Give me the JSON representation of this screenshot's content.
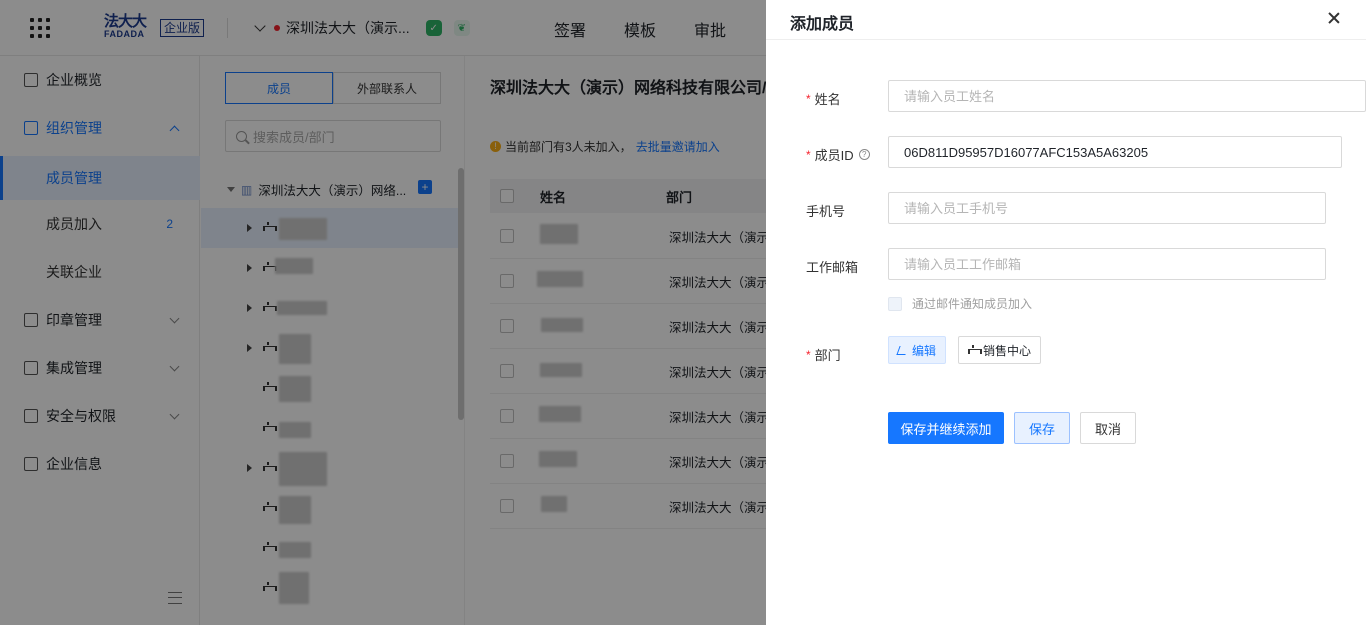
{
  "topbar": {
    "logo_zh": "法大大",
    "logo_en": "FADADA",
    "edition": "企业版",
    "org_name": "深圳法大大（演示...",
    "nav": [
      "签署",
      "模板",
      "审批"
    ]
  },
  "sidebar": {
    "items": [
      {
        "label": "企业概览"
      },
      {
        "label": "组织管理"
      },
      {
        "label": "成员管理"
      },
      {
        "label": "成员加入",
        "count": "2"
      },
      {
        "label": "关联企业"
      },
      {
        "label": "印章管理"
      },
      {
        "label": "集成管理"
      },
      {
        "label": "安全与权限"
      },
      {
        "label": "企业信息"
      }
    ]
  },
  "dept_pane": {
    "tab_members": "成员",
    "tab_external": "外部联系人",
    "search_placeholder": "搜索成员/部门",
    "root_node": "深圳法大大（演示）网络...",
    "add_label": "+"
  },
  "main": {
    "title": "深圳法大大（演示）网络科技有限公司/",
    "notice_text": "当前部门有3人未加入，",
    "notice_link": "去批量邀请加入",
    "col_name": "姓名",
    "col_dept": "部门",
    "rows": [
      {
        "dept": "深圳法大大（演示"
      },
      {
        "dept": "深圳法大大（演示"
      },
      {
        "dept": "深圳法大大（演示"
      },
      {
        "dept": "深圳法大大（演示"
      },
      {
        "dept": "深圳法大大（演示"
      },
      {
        "dept": "深圳法大大（演示"
      },
      {
        "dept": "深圳法大大（演示"
      }
    ]
  },
  "drawer": {
    "title": "添加成员",
    "name_label": "姓名",
    "name_placeholder": "请输入员工姓名",
    "id_label": "成员ID",
    "id_value": "06D811D95957D16077AFC153A5A63205",
    "phone_label": "手机号",
    "phone_placeholder": "请输入员工手机号",
    "email_label": "工作邮箱",
    "email_placeholder": "请输入员工工作邮箱",
    "email_notify": "通过邮件通知成员加入",
    "dept_label": "部门",
    "dept_edit": "编辑",
    "dept_tag": "销售中心",
    "btn_save_continue": "保存并继续添加",
    "btn_save": "保存",
    "btn_cancel": "取消",
    "required_mark": "*",
    "help_mark": "?"
  },
  "colors": {
    "accent": "#1677ff",
    "required": "#f5222d",
    "mask": "rgba(0,0,0,0.45)"
  }
}
